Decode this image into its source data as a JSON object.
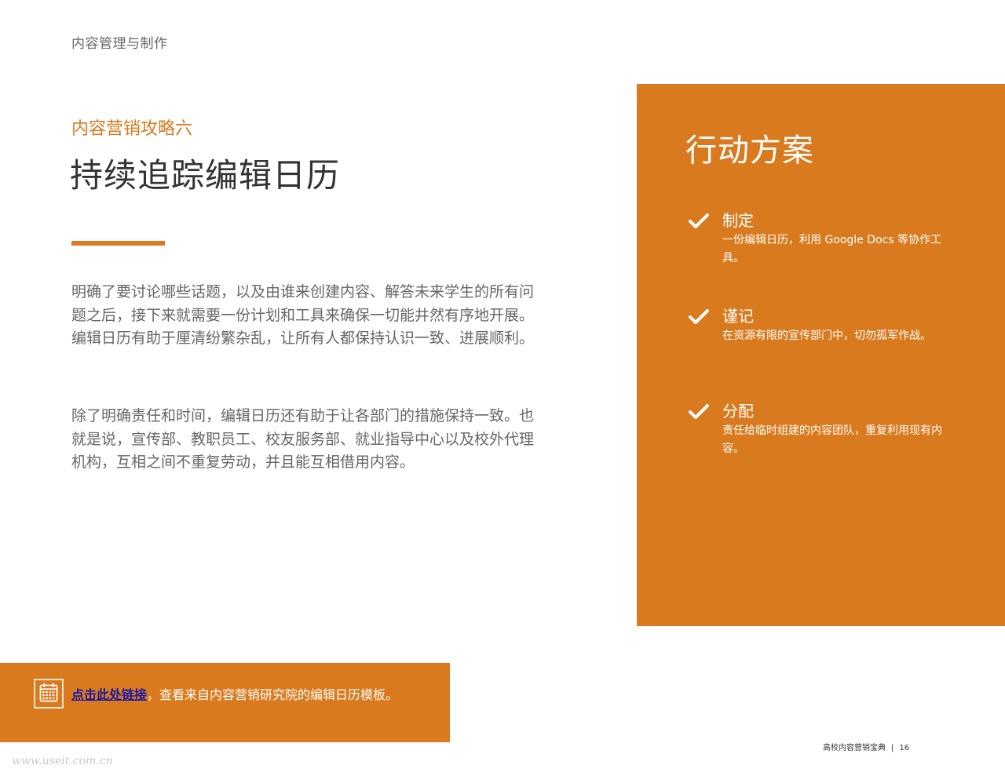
{
  "header": {
    "section": "内容管理与制作"
  },
  "article": {
    "kicker": "内容营销攻略六",
    "title": "持续追踪编辑日历",
    "paragraphs": [
      "明确了要讨论哪些话题，以及由谁来创建内容、解答未来学生的所有问题之后，接下来就需要一份计划和工具来确保一切能井然有序地开展。编辑日历有助于厘清纷繁杂乱，让所有人都保持认识一致、进展顺利。",
      "除了明确责任和时间，编辑日历还有助于让各部门的措施保持一致。也就是说，宣传部、教职员工、校友服务部、就业指导中心以及校外代理机构，互相之间不重复劳动，并且能互相借用内容。"
    ]
  },
  "action_plan": {
    "title": "行动方案",
    "items": [
      {
        "heading": "制定",
        "description": "一份编辑日历，利用 Google Docs 等协作工具。",
        "icon": "check-icon"
      },
      {
        "heading": "谨记",
        "description": "在资源有限的宣传部门中，切勿孤军作战。",
        "icon": "check-icon"
      },
      {
        "heading": "分配",
        "description": "责任给临时组建的内容团队，重复利用现有内容。",
        "icon": "check-icon"
      }
    ]
  },
  "banner": {
    "icon": "calendar-icon",
    "link_text": "点击此处链接",
    "text": "，查看来自内容营销研究院的编辑日历模板。"
  },
  "footer": {
    "publication": "高校内容营销宝典",
    "separator": "|",
    "page_number": "16"
  },
  "watermark": "www.useit.com.cn",
  "colors": {
    "accent": "#d97a1e",
    "link": "#1a1aa6",
    "title_text": "#333333",
    "body_text": "#666666"
  }
}
